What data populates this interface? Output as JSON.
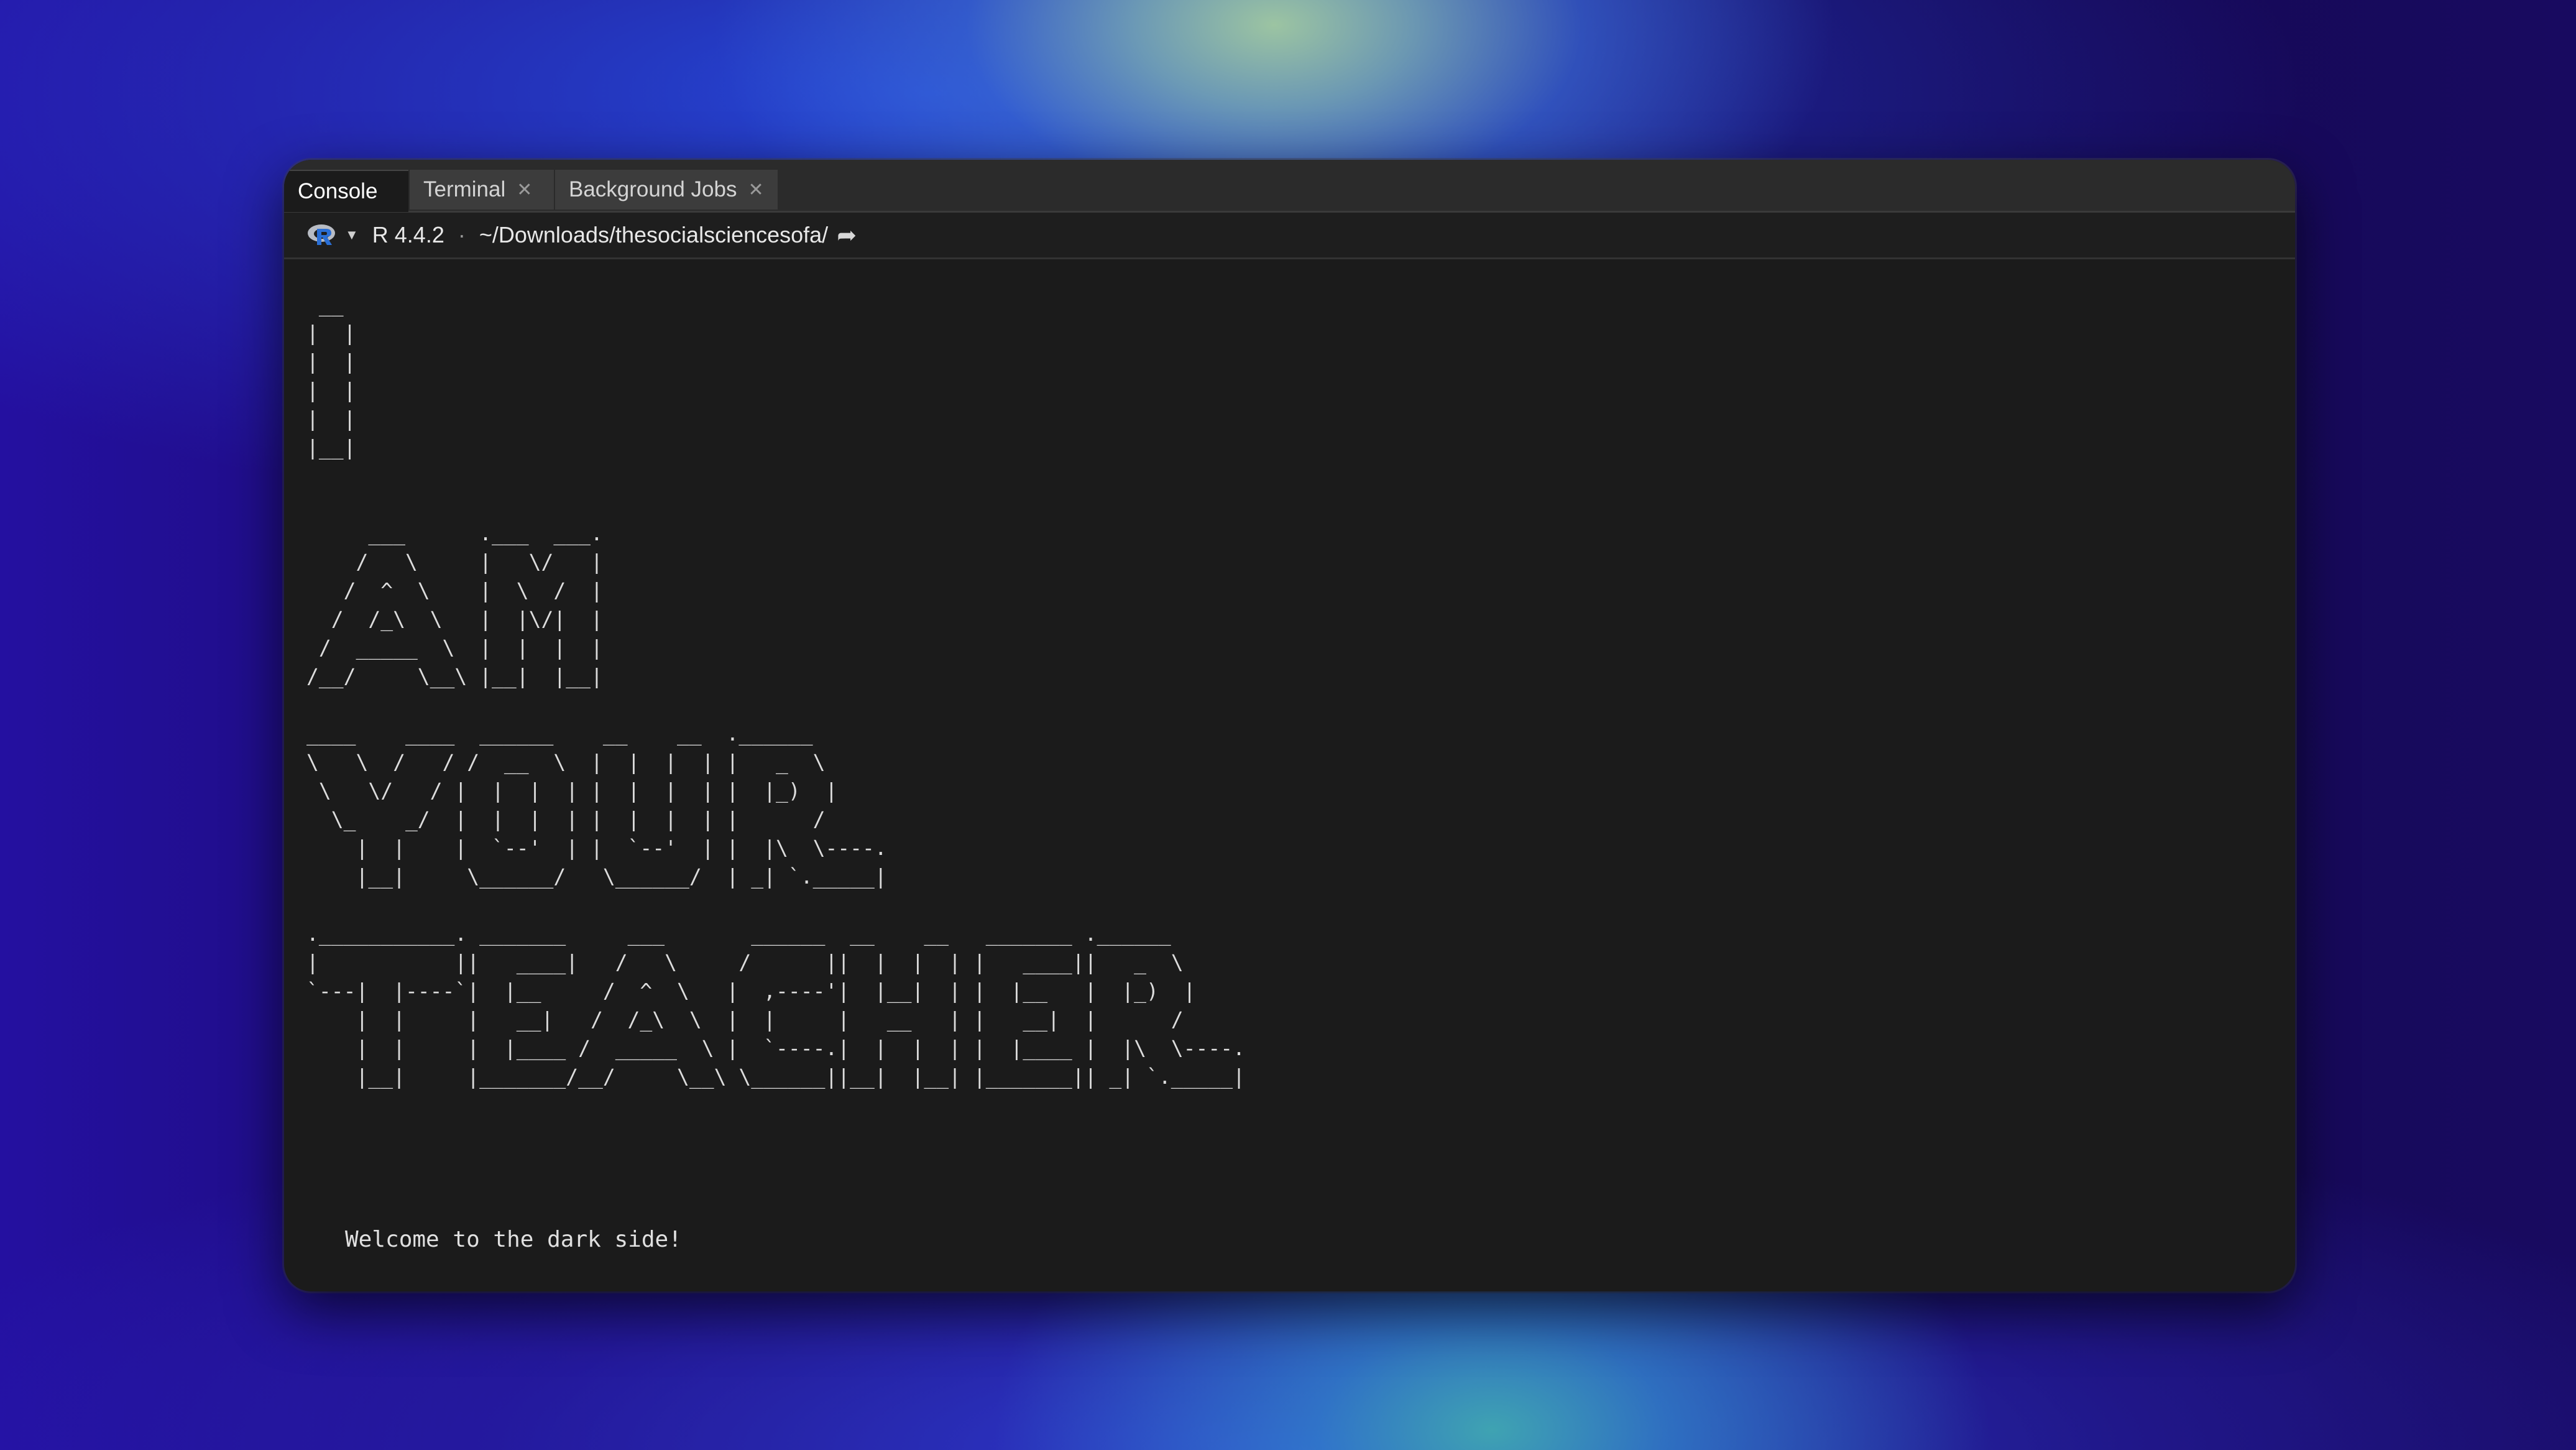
{
  "tabs": [
    {
      "label": "Console",
      "active": true,
      "closable": false
    },
    {
      "label": "Terminal",
      "active": false,
      "closable": true
    },
    {
      "label": "Background Jobs",
      "active": false,
      "closable": true
    }
  ],
  "toolbar": {
    "r_version": "R 4.4.2",
    "separator": "·",
    "working_directory": "~/Downloads/thesocialsciencesofa/",
    "logo_icon": "r-logo-icon",
    "dropdown_icon": "chevron-down-icon",
    "navigate_icon": "go-to-directory-icon"
  },
  "console": {
    "ascii_art": " __\n|  |\n|  |\n|  |\n|  |\n|__|\n\n\n     ___      .___  ___.\n    /   \\     |   \\/   |\n   /  ^  \\    |  \\  /  |\n  /  /_\\  \\   |  |\\/|  |\n /  _____  \\  |  |  |  |\n/__/     \\__\\ |__|  |__|\n\n____    ____  ______    __    __  .______\n\\   \\  /   / /  __  \\  |  |  |  | |   _  \\\n \\   \\/   / |  |  |  | |  |  |  | |  |_)  |\n  \\_    _/  |  |  |  | |  |  |  | |      /\n    |  |    |  `--'  | |  `--'  | |  |\\  \\----.\n    |__|     \\______/   \\______/  | _| `._____|\n\n.___________. _______     ___       ______  __    __   _______ .______\n|           ||   ____|   /   \\     /      ||  |  |  | |   ____||   _  \\\n`---|  |----`|  |__     /  ^  \\   |  ,----'|  |__|  | |  |__   |  |_)  |\n    |  |     |   __|   /  /_\\  \\  |  |     |   __   | |   __|  |      /\n    |  |     |  |____ /  _____  \\ |  `----.|  |  |  | |  |____ |  |\\  \\----.\n    |__|     |_______/__/     \\__\\ \\______||__|  |__| |_______|| _| `._____|",
    "welcome_message": "Welcome to the dark side!"
  },
  "colors": {
    "window_bg": "#1b1b1b",
    "tabbar_bg": "#2b2b2b",
    "text": "#dcdcdc",
    "r_logo_blue": "#2a6fd6"
  }
}
